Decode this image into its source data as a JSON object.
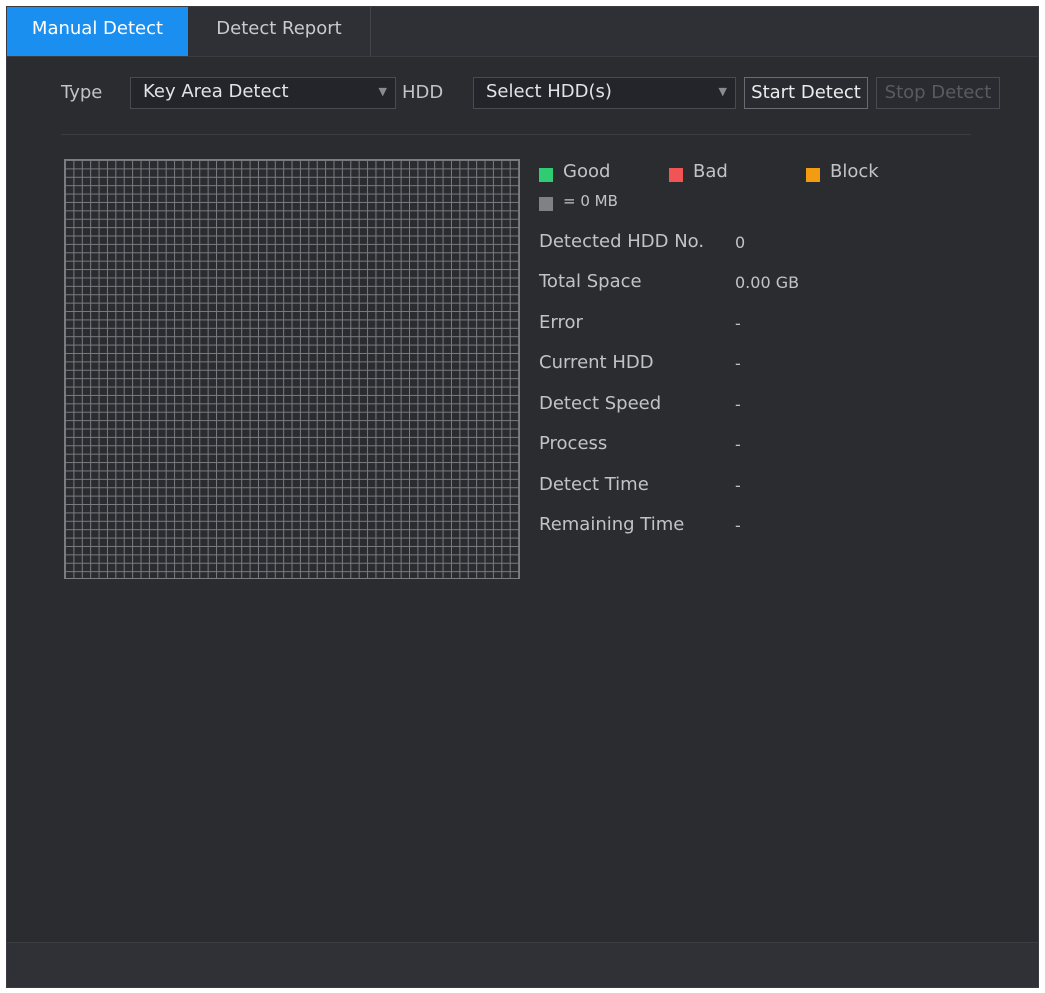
{
  "tabs": [
    {
      "label": "Manual Detect",
      "active": true
    },
    {
      "label": "Detect Report",
      "active": false
    }
  ],
  "controls": {
    "type_label": "Type",
    "type_value": "Key Area Detect",
    "hdd_label": "HDD",
    "hdd_value": "Select HDD(s)",
    "start_label": "Start Detect",
    "stop_label": "Stop Detect"
  },
  "legend": {
    "good": "Good",
    "bad": "Bad",
    "block": "Block",
    "unit": "= 0 MB",
    "colors": {
      "good": "#2fcc71",
      "bad": "#f05454",
      "block": "#f39c12",
      "unit": "#808185"
    }
  },
  "info": [
    {
      "label": "Detected HDD No.",
      "value": "0"
    },
    {
      "label": "Total Space",
      "value": "0.00 GB"
    },
    {
      "label": "Error",
      "value": "-"
    },
    {
      "label": "Current HDD",
      "value": "-"
    },
    {
      "label": "Detect Speed",
      "value": "-"
    },
    {
      "label": "Process",
      "value": "-"
    },
    {
      "label": "Detect Time",
      "value": "-"
    },
    {
      "label": "Remaining Time",
      "value": "-"
    }
  ],
  "colors": {
    "accent": "#1a8ff0",
    "background": "#2b2c30"
  }
}
